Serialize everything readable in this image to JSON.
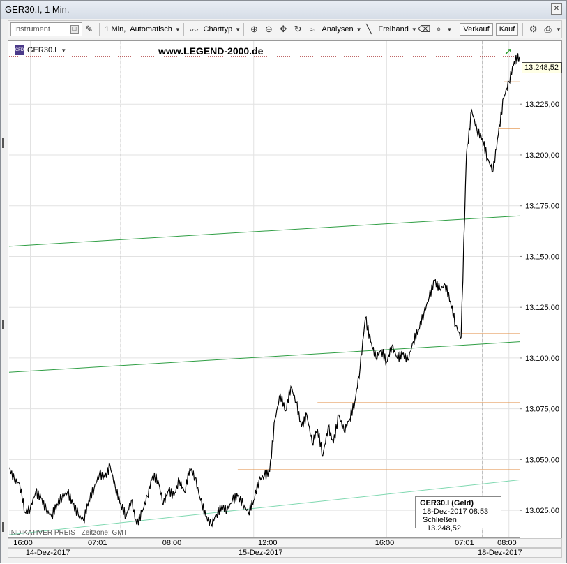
{
  "window": {
    "title": "GER30.I, 1 Min.",
    "close_icon": "close-icon"
  },
  "toolbar": {
    "instrument_placeholder": "Instrument",
    "interval_label": "1 Min,",
    "mode_label": "Automatisch",
    "charttyp_label": "Charttyp",
    "analysen_label": "Analysen",
    "freihand_label": "Freihand",
    "verkauf_label": "Verkauf",
    "kauf_label": "Kauf"
  },
  "chart_header": {
    "instrument": "GER30.I",
    "watermark": "www.LEGEND-2000.de"
  },
  "last_price": "13.248,52",
  "info_box": {
    "title": "GER30.I (Geld)",
    "datetime": "18-Dez-2017 08:53",
    "close_label": "Schließen",
    "close_value": "13.248,52"
  },
  "footer": {
    "indicative": "INDIKATIVER PREIS",
    "timezone": "Zeitzone: GMT"
  },
  "chart_data": {
    "type": "line",
    "title": "GER30.I, 1 Min.",
    "yticks": [
      "13.025,00",
      "13.050,00",
      "13.075,00",
      "13.100,00",
      "13.125,00",
      "13.150,00",
      "13.175,00",
      "13.200,00",
      "13.225,00"
    ],
    "ylim": [
      13012,
      13256
    ],
    "xticks": [
      "16:00",
      "07:01",
      "08:00",
      "12:00",
      "16:00",
      "07:01",
      "08:00"
    ],
    "dates": [
      "14-Dez-2017",
      "15-Dez-2017",
      "18-Dez-2017"
    ],
    "grid": true,
    "segments": [
      {
        "name": "14-Dez-2017",
        "points": [
          [
            0,
            13046
          ],
          [
            1,
            13040
          ],
          [
            2,
            13038
          ],
          [
            3,
            13024
          ],
          [
            4,
            13026
          ],
          [
            5,
            13034
          ],
          [
            6,
            13031
          ],
          [
            7,
            13025
          ],
          [
            8,
            13022
          ],
          [
            9,
            13028
          ],
          [
            10,
            13032
          ],
          [
            11,
            13034
          ],
          [
            12,
            13028
          ],
          [
            13,
            13023
          ],
          [
            14,
            13020
          ],
          [
            15,
            13030
          ],
          [
            16,
            13036
          ],
          [
            17,
            13043
          ],
          [
            18,
            13041
          ],
          [
            19,
            13047
          ],
          [
            20,
            13036
          ]
        ]
      },
      {
        "name": "15-Dez-2017",
        "points": [
          [
            20,
            13036
          ],
          [
            21,
            13028
          ],
          [
            22,
            13022
          ],
          [
            23,
            13030
          ],
          [
            24,
            13018
          ],
          [
            25,
            13024
          ],
          [
            26,
            13032
          ],
          [
            27,
            13042
          ],
          [
            28,
            13040
          ],
          [
            29,
            13028
          ],
          [
            30,
            13035
          ],
          [
            31,
            13032
          ],
          [
            32,
            13040
          ],
          [
            33,
            13034
          ],
          [
            34,
            13046
          ],
          [
            35,
            13041
          ],
          [
            36,
            13030
          ],
          [
            37,
            13022
          ],
          [
            38,
            13018
          ],
          [
            39,
            13023
          ],
          [
            40,
            13027
          ],
          [
            41,
            13025
          ],
          [
            42,
            13030
          ],
          [
            43,
            13032
          ],
          [
            44,
            13028
          ],
          [
            45,
            13024
          ],
          [
            46,
            13030
          ],
          [
            47,
            13040
          ],
          [
            48,
            13042
          ],
          [
            49,
            13044
          ],
          [
            50,
            13070
          ],
          [
            51,
            13082
          ],
          [
            52,
            13074
          ],
          [
            53,
            13086
          ],
          [
            54,
            13078
          ],
          [
            55,
            13066
          ],
          [
            56,
            13072
          ],
          [
            57,
            13058
          ],
          [
            58,
            13065
          ],
          [
            59,
            13052
          ],
          [
            60,
            13066
          ],
          [
            61,
            13058
          ],
          [
            62,
            13072
          ],
          [
            63,
            13064
          ],
          [
            64,
            13070
          ],
          [
            65,
            13078
          ],
          [
            66,
            13095
          ],
          [
            67,
            13120
          ],
          [
            68,
            13108
          ],
          [
            69,
            13100
          ],
          [
            70,
            13104
          ],
          [
            71,
            13098
          ],
          [
            72,
            13106
          ],
          [
            73,
            13100
          ],
          [
            74,
            13102
          ],
          [
            75,
            13099
          ],
          [
            76,
            13108
          ],
          [
            77,
            13114
          ],
          [
            78,
            13122
          ],
          [
            79,
            13130
          ],
          [
            80,
            13138
          ],
          [
            81,
            13134
          ],
          [
            82,
            13136
          ],
          [
            83,
            13128
          ],
          [
            84,
            13116
          ],
          [
            85,
            13110
          ]
        ]
      },
      {
        "name": "18-Dez-2017",
        "points": [
          [
            85,
            13110
          ],
          [
            86,
            13200
          ],
          [
            87,
            13222
          ],
          [
            88,
            13212
          ],
          [
            89,
            13208
          ],
          [
            90,
            13198
          ],
          [
            91,
            13192
          ],
          [
            92,
            13210
          ],
          [
            93,
            13228
          ],
          [
            94,
            13236
          ],
          [
            95,
            13246
          ],
          [
            96,
            13248.52
          ]
        ]
      }
    ],
    "trendlines": [
      {
        "color": "#2f9e44",
        "from": [
          0,
          13155
        ],
        "to": [
          96,
          13170
        ]
      },
      {
        "color": "#2f9e44",
        "from": [
          0,
          13093
        ],
        "to": [
          96,
          13108
        ]
      },
      {
        "color": "#7fd8b0",
        "from": [
          0,
          13013
        ],
        "to": [
          96,
          13040
        ]
      }
    ],
    "horizontal_levels": [
      {
        "color": "#e08a3c",
        "value": 13045,
        "from": 43,
        "to": 96
      },
      {
        "color": "#e08a3c",
        "value": 13078,
        "from": 58,
        "to": 96
      },
      {
        "color": "#e08a3c",
        "value": 13112,
        "from": 85,
        "to": 96
      },
      {
        "color": "#e08a3c",
        "value": 13195,
        "from": 91,
        "to": 96
      },
      {
        "color": "#e08a3c",
        "value": 13213,
        "from": 92,
        "to": 96
      },
      {
        "color": "#e08a3c",
        "value": 13236,
        "from": 93,
        "to": 96
      }
    ],
    "last_price": 13248.52,
    "line_color": "#000000"
  }
}
